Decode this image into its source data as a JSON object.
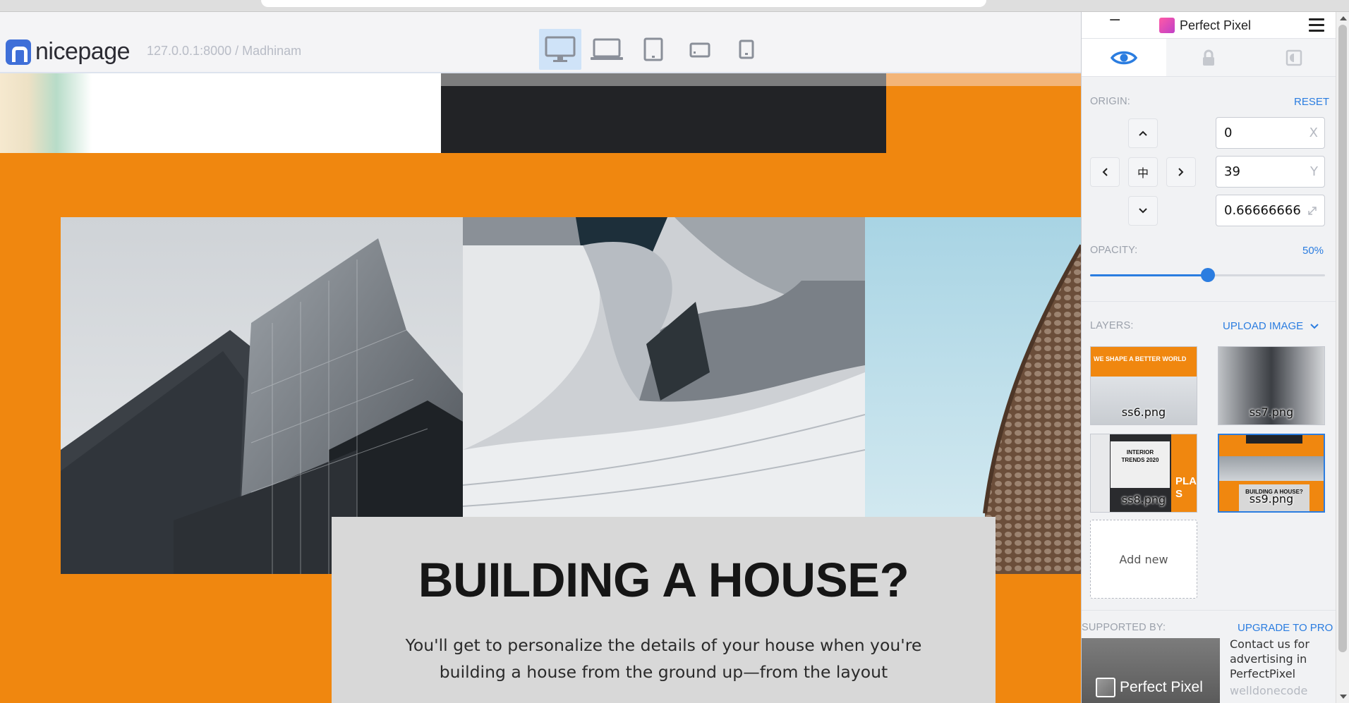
{
  "page": {
    "logo_text": "nicepage",
    "faded_address": "127.0.0.1:8000 / Madhinam"
  },
  "devices": [
    {
      "name": "desktop",
      "active": true
    },
    {
      "name": "laptop",
      "active": false
    },
    {
      "name": "tablet",
      "active": false
    },
    {
      "name": "phone-landscape",
      "active": false
    },
    {
      "name": "phone-portrait",
      "active": false
    }
  ],
  "hero": {
    "title": "BUILDING A HOUSE?",
    "body": "You'll get to personalize the details of your house when you're building a house from the ground up—from the layout",
    "accent_color": "#f0870f"
  },
  "perfect_pixel": {
    "minimize_symbol": "−",
    "brand_name": "Perfect Pixel",
    "tabs": [
      {
        "name": "visibility",
        "icon": "eye-icon",
        "active": true
      },
      {
        "name": "lock",
        "icon": "lock-icon",
        "active": false
      },
      {
        "name": "invert",
        "icon": "invert-icon",
        "active": false
      }
    ],
    "origin": {
      "label": "ORIGIN:",
      "reset_label": "RESET",
      "center_symbol": "中",
      "x": {
        "value": "0",
        "suffix": "X"
      },
      "y": {
        "value": "39",
        "suffix": "Y"
      },
      "scale": {
        "value": "0.66666666"
      }
    },
    "opacity": {
      "label": "OPACITY:",
      "value_label": "50%",
      "value": 0.5
    },
    "layers": {
      "label": "LAYERS:",
      "upload_label": "UPLOAD IMAGE",
      "items": [
        {
          "name": "ss6.png",
          "caption": "WE SHAPE A BETTER WORLD",
          "selected": false
        },
        {
          "name": "ss7.png",
          "selected": false
        },
        {
          "name": "ss8.png",
          "caption": "INTERIOR TRENDS 2020",
          "side_text": "PLA S",
          "selected": false
        },
        {
          "name": "ss9.png",
          "caption": "BUILDING A HOUSE?",
          "selected": true
        }
      ],
      "add_new_label": "Add new"
    },
    "supported": {
      "label": "SUPPORTED BY:",
      "upgrade_label": "UPGRADE TO PRO",
      "ad_logo_text": "Perfect Pixel",
      "ad_text": "Contact us for advertising in PerfectPixel",
      "ad_domain": "welldonecode"
    },
    "accent_color": "#2b7de0"
  }
}
